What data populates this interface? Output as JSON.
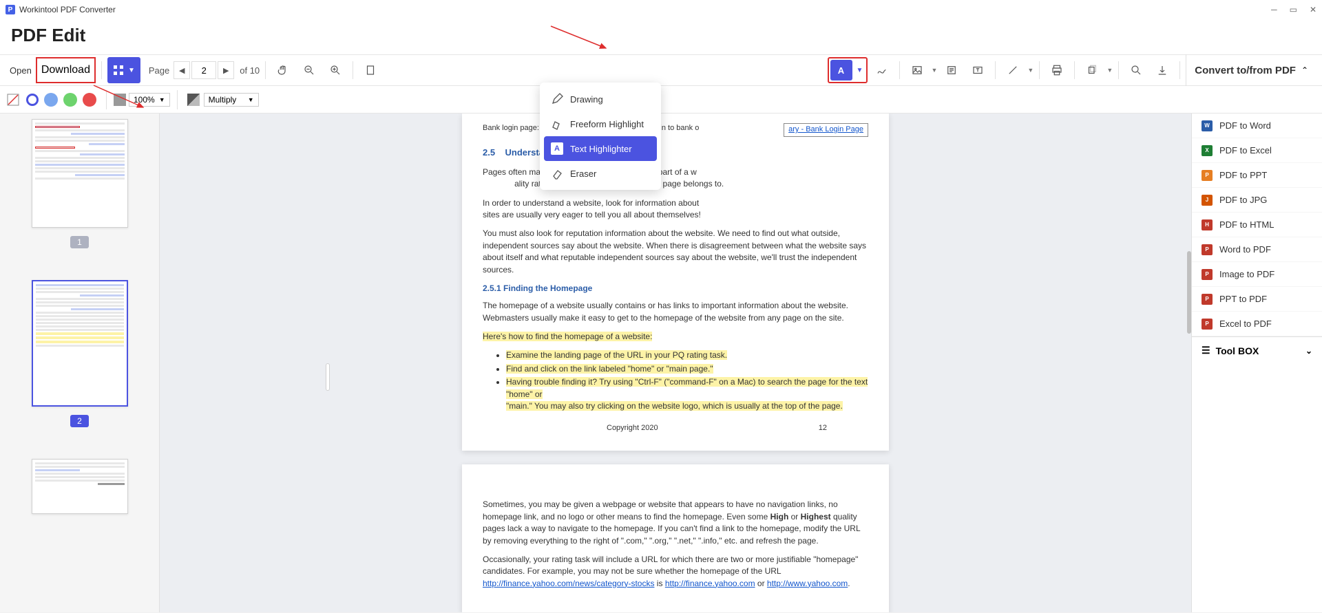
{
  "titlebar": {
    "app_name": "Workintool PDF Converter"
  },
  "header": {
    "title": "PDF Edit"
  },
  "toolbar": {
    "open": "Open",
    "download": "Download",
    "page_label": "Page",
    "page_current": "2",
    "page_total": "of 10"
  },
  "subtoolbar": {
    "opacity": "100%",
    "blend": "Multiply"
  },
  "dropdown": {
    "drawing": "Drawing",
    "freeform": "Freeform Highlight",
    "text_highlighter": "Text Highlighter",
    "eraser": "Eraser"
  },
  "thumbs": {
    "p1": "1",
    "p2": "2"
  },
  "doc": {
    "bank_desc": "Bank login page: the purpose is to allow users to log in to bank o",
    "bank_link": "ary - Bank Login Page",
    "sec25_num": "2.5",
    "sec25_title": "Understanding the Website",
    "p1": "Pages often make more sense when viewed as part of a w",
    "p1b": "ality rating are based on the website the page belongs to.",
    "p2": "In order to understand a website, look for information about",
    "p2b": "sites are usually very eager to tell you all about themselves!",
    "p3": "You must also look for reputation information about the website.  We need to find out what outside, independent sources say about the website. When there is disagreement between what the website says about itself and what reputable independent sources say about the website, we'll trust the independent sources.",
    "sec251": "2.5.1 Finding the Homepage",
    "p4": "The homepage of a website usually contains or has links to important information about the website.  Webmasters usually make it easy to get to the homepage of the website from any page on the site.",
    "howto": "Here's how to find the homepage of a website:",
    "li1": "Examine the landing page of the URL in your PQ rating task.",
    "li2": "Find and click on the link labeled \"home\" or \"main page.\"",
    "li3a": "Having trouble finding it?  Try using \"Ctrl-F\" (\"command-F\" on a Mac) to search the page for the text \"home\" or",
    "li3b": "\"main.\"  You may also try clicking on the website logo, which is usually at the top of the page.",
    "copyright": "Copyright 2020",
    "pageno": "12",
    "p5a": "Sometimes, you may be given a webpage or website that appears to have no navigation links, no homepage link, and no logo or other means to find the homepage.  Even some ",
    "p5_high": "High",
    "p5_or": " or ",
    "p5_highest": "Highest",
    "p5b": " quality pages lack a way to navigate to the homepage.  If you can't find a link to the homepage, modify the URL by removing everything to the right of \".com,\" \".org,\" \".net,\" \".info,\" etc. and refresh the page.",
    "p6a": "Occasionally, your rating task will include a URL for which there are two or more justifiable \"homepage\" candidates.  For example, you may not be sure whether the homepage of the URL ",
    "p6_link1": "http://finance.yahoo.com/news/category-stocks",
    "p6_is": " is ",
    "p6_link2": "http://finance.yahoo.com",
    "p6_or2": " or ",
    "p6_link3": "http://www.yahoo.com",
    "p6_end": "."
  },
  "convert": {
    "header": "Convert to/from PDF",
    "items": [
      {
        "label": "PDF to Word",
        "color": "#2b5da8"
      },
      {
        "label": "PDF to Excel",
        "color": "#1e7e34"
      },
      {
        "label": "PDF to PPT",
        "color": "#e67e22"
      },
      {
        "label": "PDF to JPG",
        "color": "#d35400"
      },
      {
        "label": "PDF to HTML",
        "color": "#c0392b"
      },
      {
        "label": "Word to PDF",
        "color": "#c0392b"
      },
      {
        "label": "Image to PDF",
        "color": "#c0392b"
      },
      {
        "label": "PPT to PDF",
        "color": "#c0392b"
      },
      {
        "label": "Excel to PDF",
        "color": "#c0392b"
      }
    ],
    "toolbox": "Tool BOX"
  },
  "colors": {
    "accent": "#4b53e0",
    "swatches": [
      "#4b53e0",
      "#7aa7ee",
      "#6dd36d",
      "#e84b4b",
      "#888888"
    ]
  }
}
